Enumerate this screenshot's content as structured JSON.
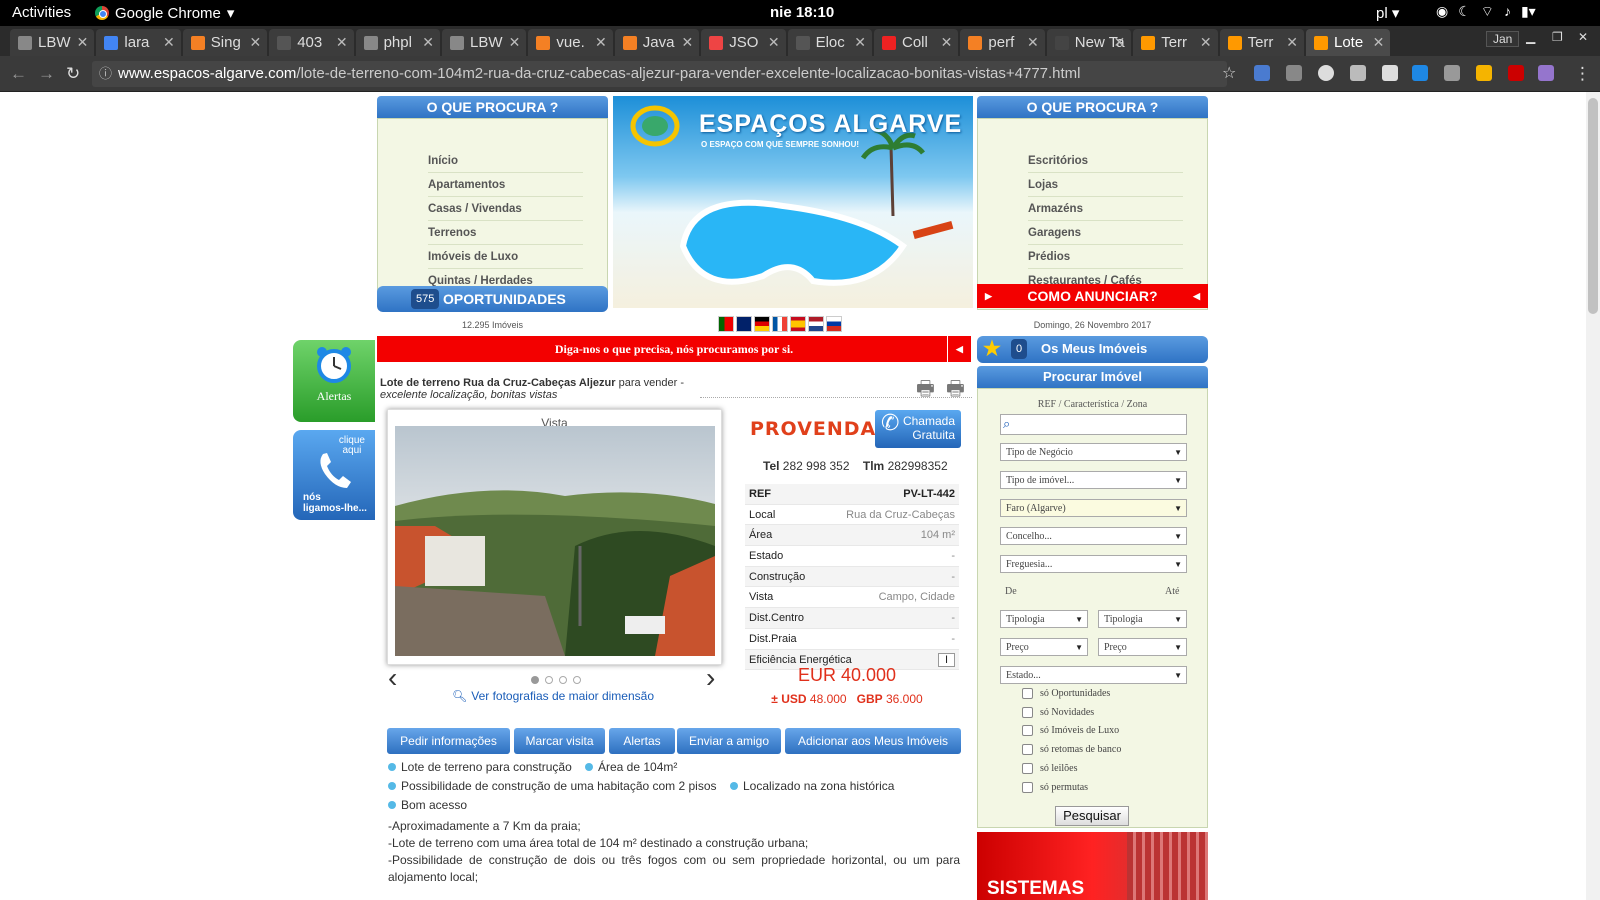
{
  "system": {
    "activities": "Activities",
    "browser": "Google Chrome",
    "clock": "nie 18:10",
    "lang": "pl"
  },
  "tabs": [
    {
      "label": "LBW",
      "color": "#888"
    },
    {
      "label": "lara",
      "color": "#4285f4"
    },
    {
      "label": "Sing",
      "color": "#f48024"
    },
    {
      "label": "403",
      "color": "#555"
    },
    {
      "label": "phpl",
      "color": "#888"
    },
    {
      "label": "LBW",
      "color": "#888"
    },
    {
      "label": "vue.",
      "color": "#f48024"
    },
    {
      "label": "Java",
      "color": "#f48024"
    },
    {
      "label": "JSO",
      "color": "#e44"
    },
    {
      "label": "Eloc",
      "color": "#555"
    },
    {
      "label": "Coll",
      "color": "#e22"
    },
    {
      "label": "perf",
      "color": "#f48024"
    },
    {
      "label": "New Ta",
      "color": "#444"
    },
    {
      "label": "Terr",
      "color": "#f90"
    },
    {
      "label": "Terr",
      "color": "#f90"
    },
    {
      "label": "Lote",
      "color": "#f90"
    }
  ],
  "window": {
    "user": "Jan"
  },
  "url": {
    "host": "www.espacos-algarve.com",
    "path": "/lote-de-terreno-com-104m2-rua-da-cruz-cabecas-aljezur-para-vender-excelente-localizacao-bonitas-vistas+4777.html"
  },
  "left_menu": {
    "title": "O QUE PROCURA ?",
    "items": [
      "Início",
      "Apartamentos",
      "Casas / Vivendas",
      "Terrenos",
      "Imóveis de Luxo",
      "Quintas / Herdades"
    ],
    "count": "575",
    "oport": "OPORTUNIDADES",
    "imoveis": "12.295 Imóveis"
  },
  "right_menu": {
    "title": "O QUE PROCURA ?",
    "items": [
      "Escritórios",
      "Lojas",
      "Armazéns",
      "Garagens",
      "Prédios",
      "Restaurantes / Cafés"
    ],
    "anunciar": "COMO ANUNCIAR?",
    "date": "Domingo, 26 Novembro 2017"
  },
  "banner": {
    "title": "ESPAÇOS ALGARVE",
    "slogan": "O ESPAÇO COM QUE SEMPRE SONHOU!"
  },
  "side": {
    "alertas": "Alertas",
    "clique": "clique",
    "aqui": "aqui",
    "nos": "nós",
    "ligamos": "ligamos-lhe..."
  },
  "red_banner": "Diga-nos o que precisa, nós procuramos por si.",
  "listing": {
    "title_bold": "Lote de terreno Rua da Cruz-Cabeças Aljezur",
    "title_rest": " para vender - ",
    "title_italic": "excelente localização, bonitas vistas",
    "photo_caption": "Vista",
    "ver_fotos": "Ver fotografias de maior dimensão",
    "agency": "PROVENDA II",
    "chamada": "Chamada",
    "gratuita": "Gratuita",
    "tel_label": "Tel",
    "tel": "282 998 352",
    "tlm_label": "Tlm",
    "tlm": "282998352",
    "details": [
      {
        "k": "REF",
        "v": "PV-LT-442"
      },
      {
        "k": "Local",
        "v": "Rua da Cruz-Cabeças"
      },
      {
        "k": "Área",
        "v": "104 m²"
      },
      {
        "k": "Estado",
        "v": "-"
      },
      {
        "k": "Construção",
        "v": "-"
      },
      {
        "k": "Vista",
        "v": "Campo, Cidade"
      },
      {
        "k": "Dist.Centro",
        "v": "-"
      },
      {
        "k": "Dist.Praia",
        "v": "-"
      },
      {
        "k": "Eficiência Energética",
        "v": "I"
      }
    ],
    "price": "EUR 40.000",
    "usd_label": "± USD",
    "usd": "48.000",
    "gbp_label": "GBP",
    "gbp": "36.000",
    "buttons": [
      "Pedir informações",
      "Marcar visita",
      "Alertas",
      "Enviar a amigo",
      "Adicionar aos Meus Imóveis"
    ],
    "features": [
      "Lote de terreno para construção",
      "Área de 104m²",
      "Possibilidade de construção de uma habitação com 2 pisos",
      "Localizado na zona histórica",
      "Bom acesso"
    ],
    "description": [
      "-Aproximadamente a 7 Km da praia;",
      "-Lote de terreno com uma área total de 104 m² destinado a construção urbana;",
      "-Possibilidade de construção de dois ou três fogos com ou sem propriedade horizontal, ou um para alojamento local;"
    ]
  },
  "search": {
    "meus_count": "0",
    "meus_label": "Os Meus Imóveis",
    "title": "Procurar Imóvel",
    "ref_label": "REF / Característica / Zona",
    "negocio": "Tipo de Negócio",
    "imovel": "Tipo de imóvel...",
    "distrito": "Faro (Algarve)",
    "concelho": "Concelho...",
    "freguesia": "Freguesia...",
    "de": "De",
    "ate": "Até",
    "tipologia": "Tipologia",
    "preco": "Preço",
    "estado": "Estado...",
    "checks": [
      "só Oportunidades",
      "só Novidades",
      "só Imóveis de Luxo",
      "só retomas de banco",
      "só leilões",
      "só permutas"
    ],
    "pesquisar": "Pesquisar"
  },
  "ad": {
    "text": "SISTEMAS"
  }
}
